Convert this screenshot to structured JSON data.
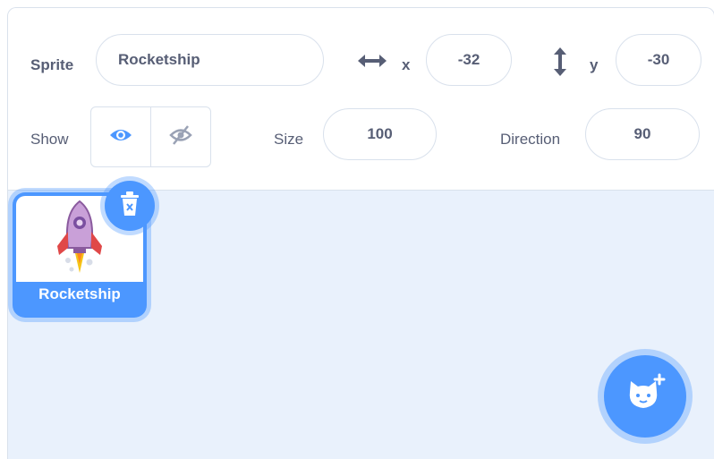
{
  "sprite_info": {
    "sprite_label": "Sprite",
    "sprite_name": "Rocketship",
    "x_label": "x",
    "x_value": "-32",
    "y_label": "y",
    "y_value": "-30",
    "show_label": "Show",
    "show_visible": true,
    "size_label": "Size",
    "size_value": "100",
    "direction_label": "Direction",
    "direction_value": "90",
    "icons": {
      "x": "horizontal-arrows-icon",
      "y": "vertical-arrows-icon",
      "show": "eye-icon",
      "hide": "eye-slash-icon"
    }
  },
  "sprite_list": {
    "sprites": [
      {
        "name": "Rocketship",
        "selected": true
      }
    ],
    "delete_icon": "trash-icon",
    "add_sprite_icon": "cat-plus-icon"
  },
  "colors": {
    "accent": "#4c97ff",
    "text": "#575e75",
    "border": "#d9e1ec",
    "pane_bg": "#e9f1fc"
  }
}
